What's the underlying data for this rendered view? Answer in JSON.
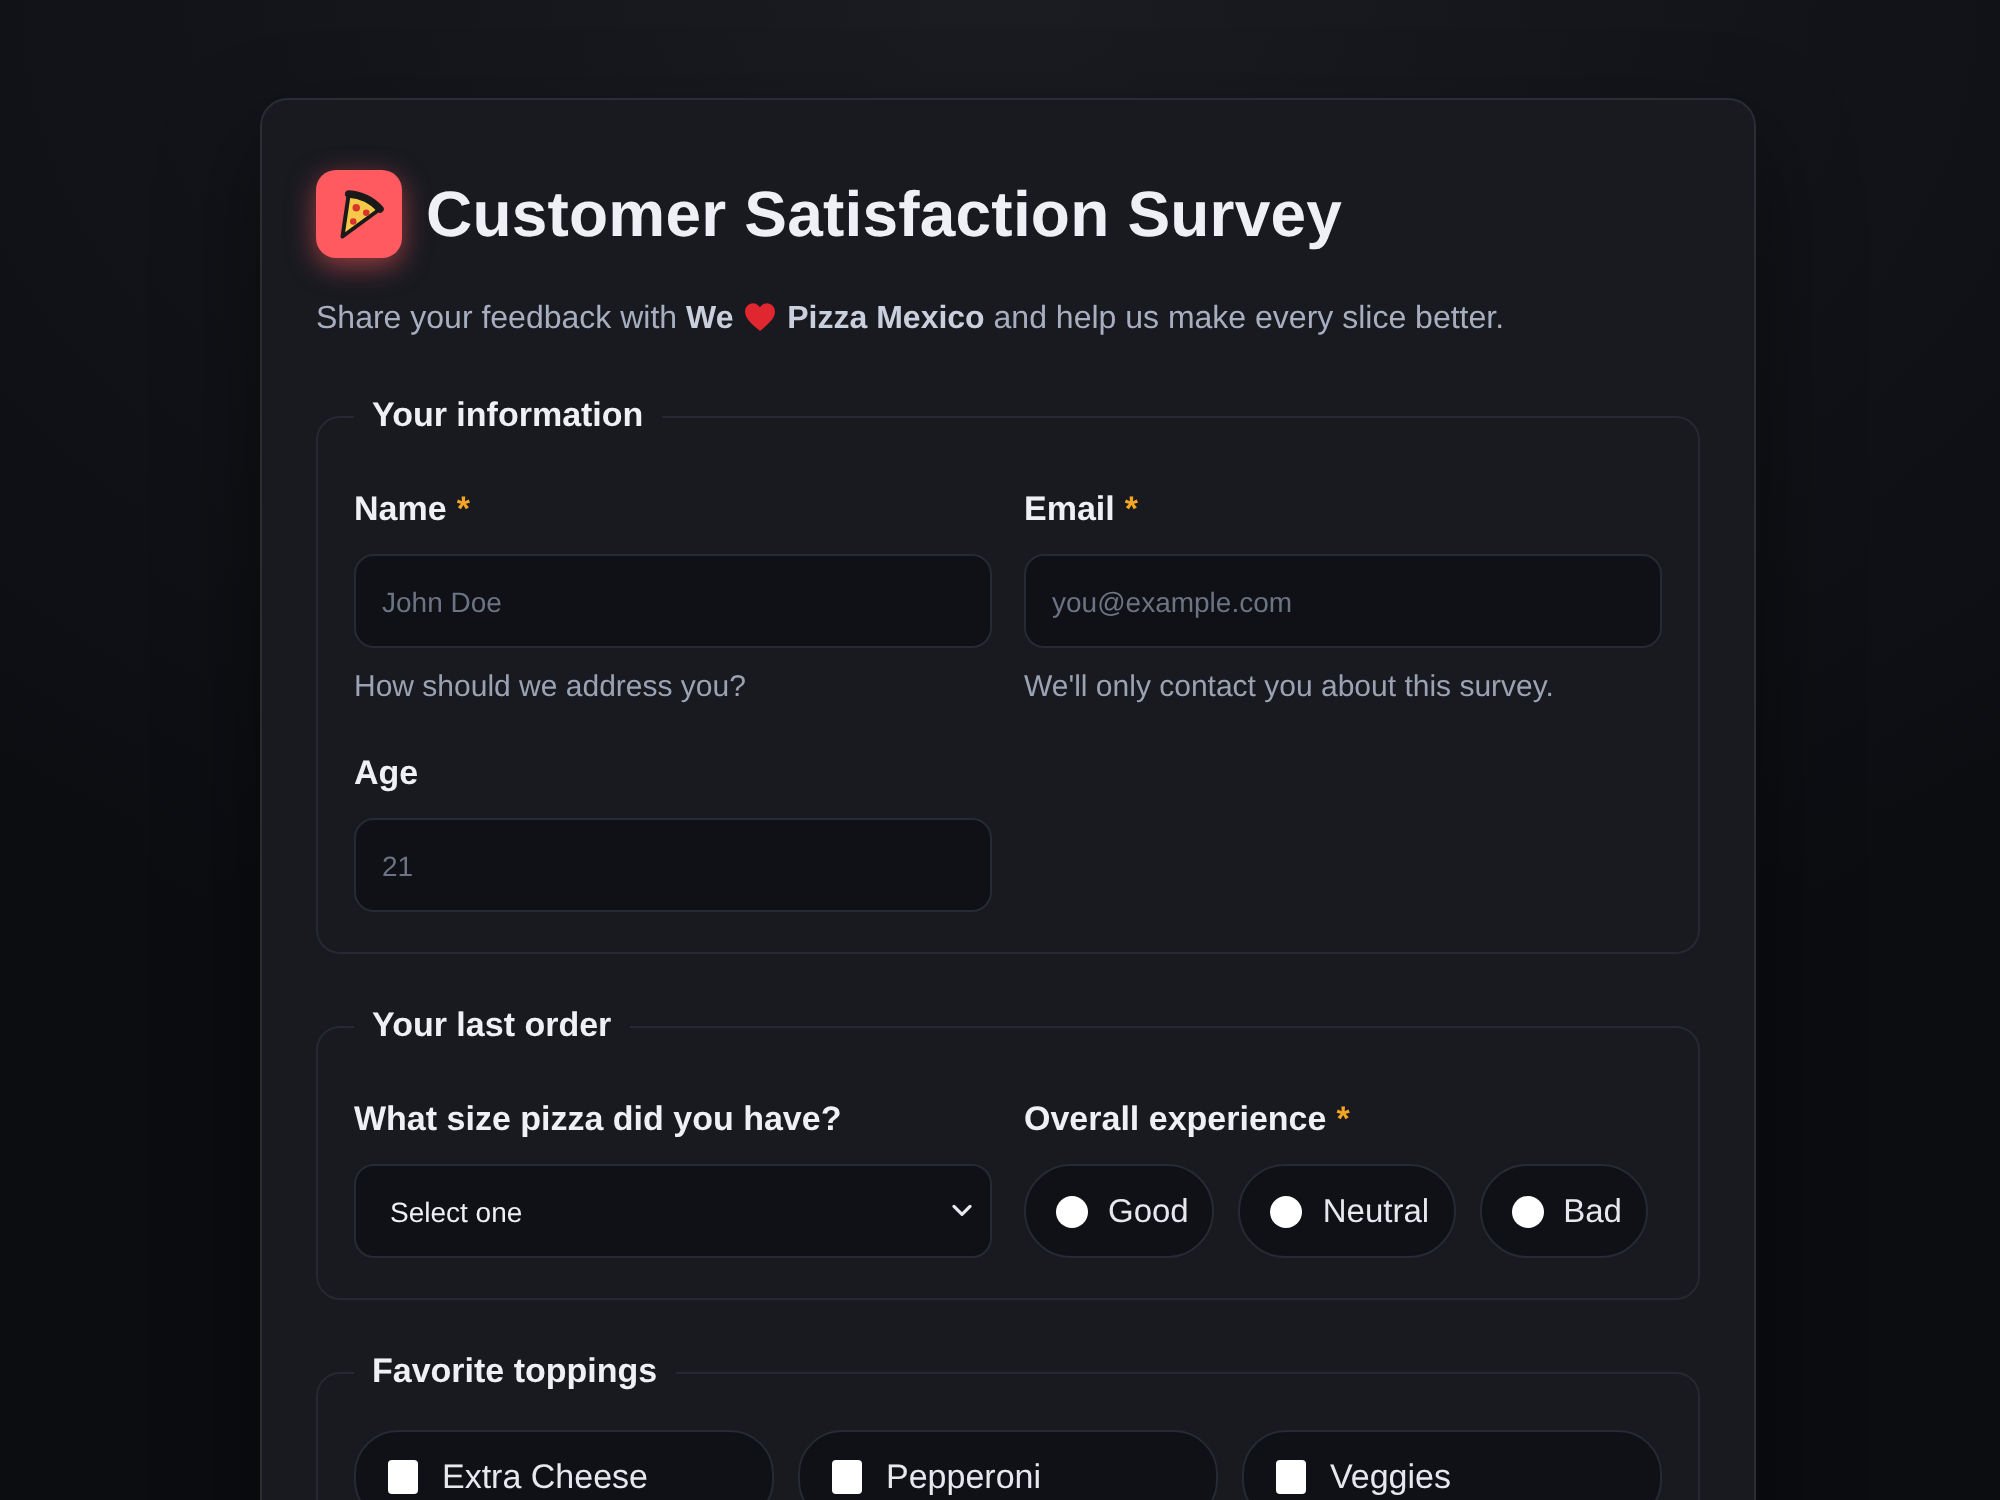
{
  "header": {
    "title": "Customer Satisfaction Survey",
    "subtitle_before": "Share your feedback with **We**",
    "subtitle_after": "**Pizza Mexico** and help us make every slice better."
  },
  "sections": [
    {
      "legend": "Your information",
      "fields": [
        {
          "kind": "text",
          "label": "Name",
          "required_mark": "*",
          "placeholder": "John Doe",
          "hint": "How should we address you?"
        },
        {
          "kind": "text",
          "label": "Email",
          "required_mark": "*",
          "placeholder": "you@example.com",
          "hint": "We'll only contact you about this survey."
        },
        {
          "kind": "text",
          "label": "Age",
          "placeholder": "21"
        }
      ]
    },
    {
      "legend": "Your last order",
      "fields": [
        {
          "kind": "select",
          "label": "What size pizza did you have?",
          "value": "Select one"
        },
        {
          "kind": "radio",
          "label": "Overall experience",
          "required_mark": "*",
          "options": [
            {
              "label": "Good",
              "selected": false
            },
            {
              "label": "Neutral",
              "selected": false
            },
            {
              "label": "Bad",
              "selected": false
            }
          ]
        }
      ]
    },
    {
      "legend": "Favorite toppings",
      "fields": [
        {
          "kind": "checkbox",
          "options": [
            {
              "label": "Extra Cheese",
              "checked": false
            },
            {
              "label": "Pepperoni",
              "checked": false
            },
            {
              "label": "Veggies",
              "checked": false
            }
          ]
        }
      ]
    }
  ]
}
